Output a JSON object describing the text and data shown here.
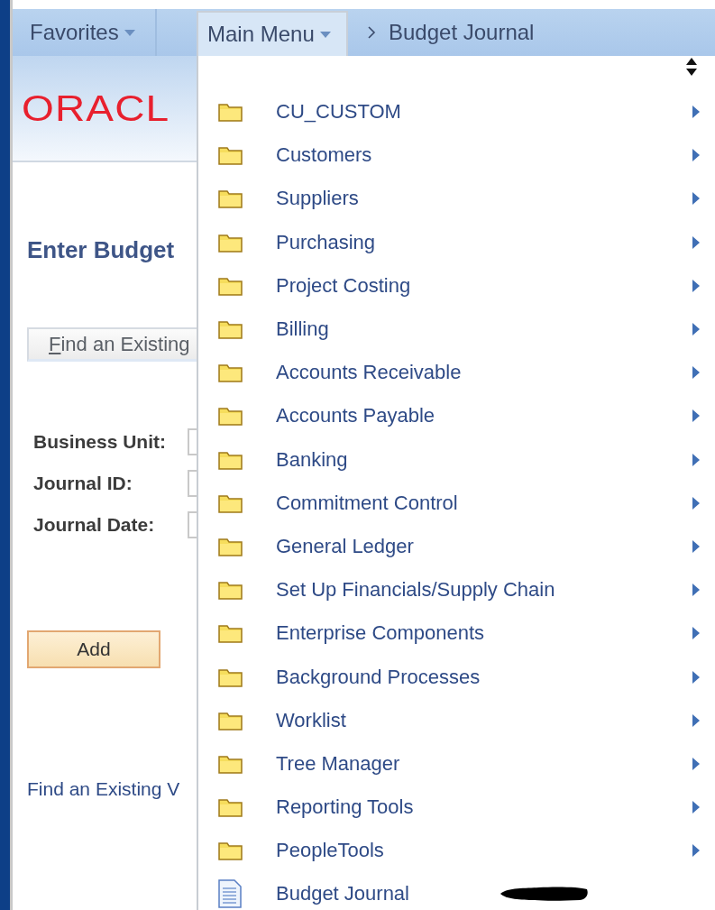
{
  "header": {
    "favorites": "Favorites",
    "main_menu": "Main Menu",
    "breadcrumb": "Budget Journal"
  },
  "logo": "ORACL",
  "page": {
    "title": "Enter Budget",
    "tab": "Find an Existing",
    "fields": [
      {
        "label": "Business Unit:"
      },
      {
        "label": "Journal ID:"
      },
      {
        "label": "Journal Date:"
      }
    ],
    "add_button": "Add",
    "link": "Find an Existing V"
  },
  "menu": {
    "items": [
      {
        "label": "CU_CUSTOM",
        "kind": "folder"
      },
      {
        "label": "Customers",
        "kind": "folder"
      },
      {
        "label": "Suppliers",
        "kind": "folder"
      },
      {
        "label": "Purchasing",
        "kind": "folder"
      },
      {
        "label": "Project Costing",
        "kind": "folder"
      },
      {
        "label": "Billing",
        "kind": "folder"
      },
      {
        "label": "Accounts Receivable",
        "kind": "folder"
      },
      {
        "label": "Accounts Payable",
        "kind": "folder"
      },
      {
        "label": "Banking",
        "kind": "folder"
      },
      {
        "label": "Commitment Control",
        "kind": "folder"
      },
      {
        "label": "General Ledger",
        "kind": "folder"
      },
      {
        "label": "Set Up Financials/Supply Chain",
        "kind": "folder"
      },
      {
        "label": "Enterprise Components",
        "kind": "folder"
      },
      {
        "label": "Background Processes",
        "kind": "folder"
      },
      {
        "label": "Worklist",
        "kind": "folder"
      },
      {
        "label": "Tree Manager",
        "kind": "folder"
      },
      {
        "label": "Reporting Tools",
        "kind": "folder"
      },
      {
        "label": "PeopleTools",
        "kind": "folder"
      },
      {
        "label": "Budget Journal",
        "kind": "page"
      }
    ]
  }
}
